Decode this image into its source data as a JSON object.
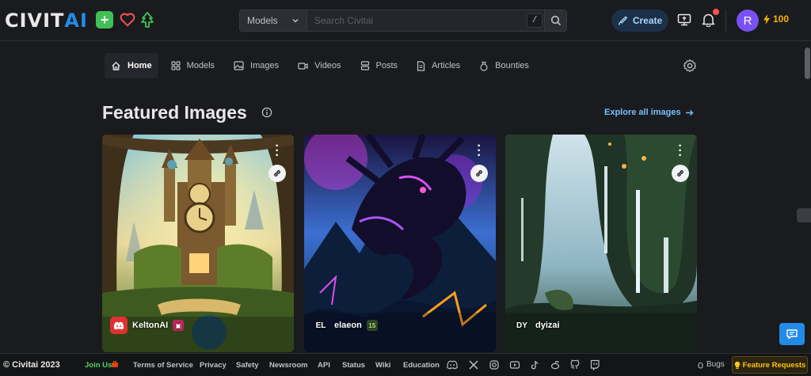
{
  "brand": {
    "logo_part1": "CIVIT",
    "logo_part2": "AI"
  },
  "header": {
    "search_category": "Models",
    "search_placeholder": "Search Civitai",
    "search_shortcut": "/",
    "create_label": "Create",
    "avatar_initial": "R",
    "buzz_amount": "100"
  },
  "subnav": {
    "items": [
      {
        "label": "Home",
        "icon": "home-icon",
        "active": true
      },
      {
        "label": "Models",
        "icon": "grid-icon"
      },
      {
        "label": "Images",
        "icon": "image-icon"
      },
      {
        "label": "Videos",
        "icon": "video-icon"
      },
      {
        "label": "Posts",
        "icon": "stack-icon"
      },
      {
        "label": "Articles",
        "icon": "article-icon"
      },
      {
        "label": "Bounties",
        "icon": "moneybag-icon"
      }
    ]
  },
  "featured": {
    "title": "Featured Images",
    "explore_label": "Explore all images",
    "cards": [
      {
        "user": "KeltonAI",
        "avatar_text": "",
        "avatar_color": "#e03131"
      },
      {
        "user": "elaeon",
        "avatar_text": "EL",
        "avatar_color": "transparent",
        "badge": "15"
      },
      {
        "user": "dyizai",
        "avatar_text": "DY",
        "avatar_color": "transparent"
      }
    ]
  },
  "footer": {
    "copyright": "© Civitai 2023",
    "links": [
      "Join Us",
      "Terms of Service",
      "Privacy",
      "Safety",
      "Newsroom",
      "API",
      "Status",
      "Wiki",
      "Education"
    ],
    "bugs_label": "Bugs",
    "feature_requests_label": "Feature Requests"
  },
  "colors": {
    "accent": "#228be6",
    "bg": "#1a1b1e",
    "buzz": "#fab005",
    "join": "#51cf66"
  }
}
